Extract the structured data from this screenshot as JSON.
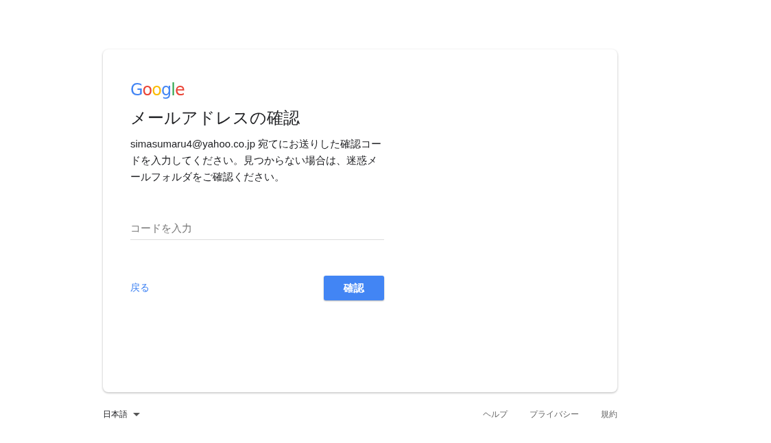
{
  "logo": "Google",
  "title": "メールアドレスの確認",
  "description": "simasumaru4@yahoo.co.jp 宛てにお送りした確認コードを入力してください。見つからない場合は、迷惑メールフォルダをご確認ください。",
  "code_field": {
    "placeholder": "コードを入力"
  },
  "back_link": "戻る",
  "confirm_button": "確認",
  "footer": {
    "language": "日本語",
    "links": [
      "ヘルプ",
      "プライバシー",
      "規約"
    ]
  }
}
